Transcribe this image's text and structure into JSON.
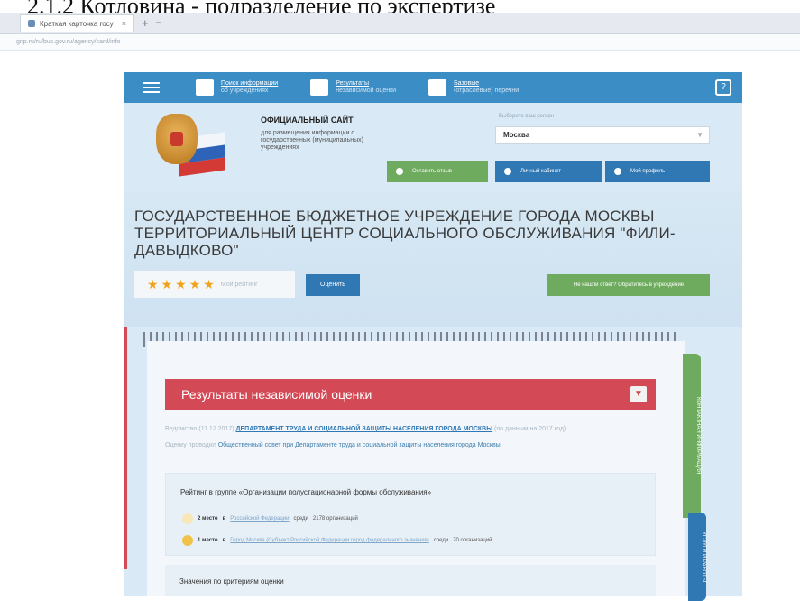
{
  "page_caption": "2.1.2 Котловина - подразделение по экспертизе",
  "browser": {
    "tab_title": "Краткая карточка госу",
    "tab_close": "×",
    "new_tab": "+",
    "tab_menu": "~",
    "address": "grip.ru/ru/bus.gov.ru/agency/card/info"
  },
  "nav": {
    "items": [
      {
        "title": "Поиск информации",
        "sub": "об учреждениях"
      },
      {
        "title": "Результаты",
        "sub": "независимой оценки"
      },
      {
        "title": "Базовые",
        "sub": "(отраслевые) перечни"
      }
    ],
    "help": "?"
  },
  "header": {
    "site_title": "ОФИЦИАЛЬНЫЙ САЙТ",
    "site_sub": "для размещения информации о государственных (муниципальных) учреждениях",
    "region_label": "Выберите ваш регион",
    "region_value": "Москва",
    "buttons": {
      "feedback": "Оставить отзыв",
      "cabinet": "Личный кабинет",
      "profile": "Мой профиль"
    }
  },
  "org": {
    "name": "ГОСУДАРСТВЕННОЕ БЮДЖЕТНОЕ УЧРЕЖДЕНИЕ ГОРОДА МОСКВЫ ТЕРРИТОРИАЛЬНЫЙ ЦЕНТР СОЦИАЛЬНОГО ОБСЛУЖИВАНИЯ \"ФИЛИ-ДАВЫДКОВО\"",
    "rating_label": "Мой рейтинг",
    "rating_stars": 5,
    "rate_button": "Оценить",
    "banner": "Не нашли ответ? Обратитесь в учреждение"
  },
  "results": {
    "title": "Результаты независимой оценки",
    "agency_prefix": "Ведомство (11.12.2017)",
    "agency": "ДЕПАРТАМЕНТ ТРУДА И СОЦИАЛЬНОЙ ЗАЩИТЫ НАСЕЛЕНИЯ ГОРОДА МОСКВЫ",
    "agency_suffix": "(по данным на 2017 год)",
    "operator_prefix": "Оценку проводил",
    "operator": "Общественный совет при Департаменте труда и социальной защиты населения города Москвы",
    "group_title": "Рейтинг в группе «Организации полустационарной формы обслуживания»",
    "ranks": [
      {
        "place": "2 место",
        "in": "в",
        "scope": "Российской Федерации",
        "among": "среди",
        "count": "2178 организаций"
      },
      {
        "place": "1 место",
        "in": "в",
        "scope": "Город Москва (Субъект Российской Федерации город федерального значения)",
        "among": "среди",
        "count": "70 организаций"
      }
    ],
    "criteria_title": "Значения по критериям оценки"
  },
  "side_tabs": {
    "green": "КОНТАКТНАЯ ИНФОРМАЦИЯ",
    "blue": "УСЛУГИ И РАБОТЫ"
  },
  "colors": {
    "nav_blue": "#3b8dc6",
    "accent_red": "#d34a56",
    "accent_green": "#6fab5e",
    "button_blue": "#2f78b4",
    "star": "#f0a31a"
  }
}
